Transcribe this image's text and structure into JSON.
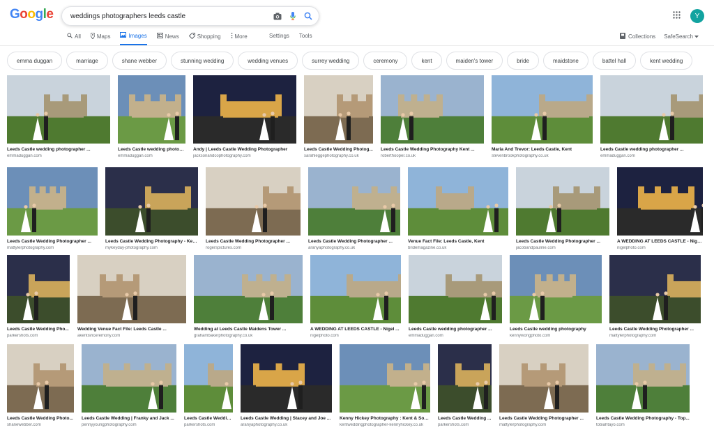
{
  "header": {
    "logo_letters": [
      "G",
      "o",
      "o",
      "g",
      "l",
      "e"
    ],
    "logo_colors": [
      "#4285f4",
      "#ea4335",
      "#fbbc05",
      "#4285f4",
      "#34a853",
      "#ea4335"
    ],
    "query": "weddings photographers leeds castle",
    "avatar_letter": "Y"
  },
  "tabs": [
    {
      "label": "All",
      "icon": "search-icon"
    },
    {
      "label": "Maps",
      "icon": "pin-icon"
    },
    {
      "label": "Images",
      "icon": "image-icon",
      "active": true
    },
    {
      "label": "News",
      "icon": "news-icon"
    },
    {
      "label": "Shopping",
      "icon": "tag-icon"
    },
    {
      "label": "More",
      "icon": "more-vert-icon"
    }
  ],
  "tools": [
    "Settings",
    "Tools"
  ],
  "right_links": {
    "collections": "Collections",
    "safesearch": "SafeSearch"
  },
  "chips": [
    "emma duggan",
    "marriage",
    "shane webber",
    "stunning wedding",
    "wedding venues",
    "surrey wedding",
    "ceremony",
    "kent",
    "maiden's tower",
    "bride",
    "maidstone",
    "battel hall",
    "kent wedding"
  ],
  "rows": [
    [
      {
        "title": "Leeds Castle wedding photographer ...",
        "source": "emmaduggan.com"
      },
      {
        "title": "Leeds Castle wedding photog...",
        "source": "emmaduggan.com"
      },
      {
        "title": "Andy | Leeds Castle Wedding Photographer",
        "source": "jacksonandcophotography.com"
      },
      {
        "title": "Leeds Castle Wedding Photog...",
        "source": "sarahleggephotography.co.uk"
      },
      {
        "title": "Leeds Castle Wedding Photography Kent ...",
        "source": "roberthooper.co.uk"
      },
      {
        "title": "Maria And Trevor: Leeds Castle, Kent",
        "source": "stevenbrookphotography.co.uk"
      },
      {
        "title": "Leeds Castle wedding photographer ...",
        "source": "emmaduggan.com"
      }
    ],
    [
      {
        "title": "Leeds Castle Wedding Photographer ...",
        "source": "mattylerphotography.com"
      },
      {
        "title": "Leeds Castle Wedding Photography - Kent...",
        "source": "mykeyday-photography.com"
      },
      {
        "title": "Leeds Castle Wedding Photographer ...",
        "source": "rogerspictures.com"
      },
      {
        "title": "Leeds Castle Wedding Photographer ...",
        "source": "aranyaphotography.co.uk"
      },
      {
        "title": "Venue Fact File: Leeds Castle, Kent",
        "source": "bridemagazine.co.uk"
      },
      {
        "title": "Leeds Castle Wedding Photographer ...",
        "source": "jacobandpauline.com"
      },
      {
        "title": "A WEDDING AT LEEDS CASTLE - Nigel...",
        "source": "nigelphoto.com"
      }
    ],
    [
      {
        "title": "Leeds Castle Wedding Pho...",
        "source": "parkershots.com"
      },
      {
        "title": "Wedding Venue Fact File: Leeds Castle ...",
        "source": "akentishceremony.com"
      },
      {
        "title": "Wedding at Leeds Castle Maidens Tower ...",
        "source": "grahambakerphotography.co.uk"
      },
      {
        "title": "A WEDDING AT LEEDS CASTLE - Nigel ...",
        "source": "nigelphoto.com"
      },
      {
        "title": "Leeds Castle wedding photographer ...",
        "source": "emmaduggan.com"
      },
      {
        "title": "Leeds Castle wedding photography",
        "source": "kennywongphoto.com"
      },
      {
        "title": "Leeds Castle Wedding Photographer ...",
        "source": "mattylerphotography.com"
      }
    ],
    [
      {
        "title": "Leeds Castle Wedding Photo...",
        "source": "shanewebber.com"
      },
      {
        "title": "Leeds Castle Wedding | Franky and Jack ...",
        "source": "pennyyoungphotography.com"
      },
      {
        "title": "Leeds Castle Wedding ...",
        "source": "parkershots.com"
      },
      {
        "title": "Leeds Castle Wedding | Stacey and Joe ...",
        "source": "aranyaphotography.co.uk"
      },
      {
        "title": "Kenny Hickey Photography : Kent & Sout...",
        "source": "kentweddingphotographer-kennyhickey.co.uk"
      },
      {
        "title": "Leeds Castle Wedding ...",
        "source": "parkershots.com"
      },
      {
        "title": "Leeds Castle Wedding Photographer ...",
        "source": "mattylerphotography.com"
      },
      {
        "title": "Leeds Castle Wedding Photography - Top...",
        "source": "tobiahtayo.com"
      }
    ]
  ]
}
